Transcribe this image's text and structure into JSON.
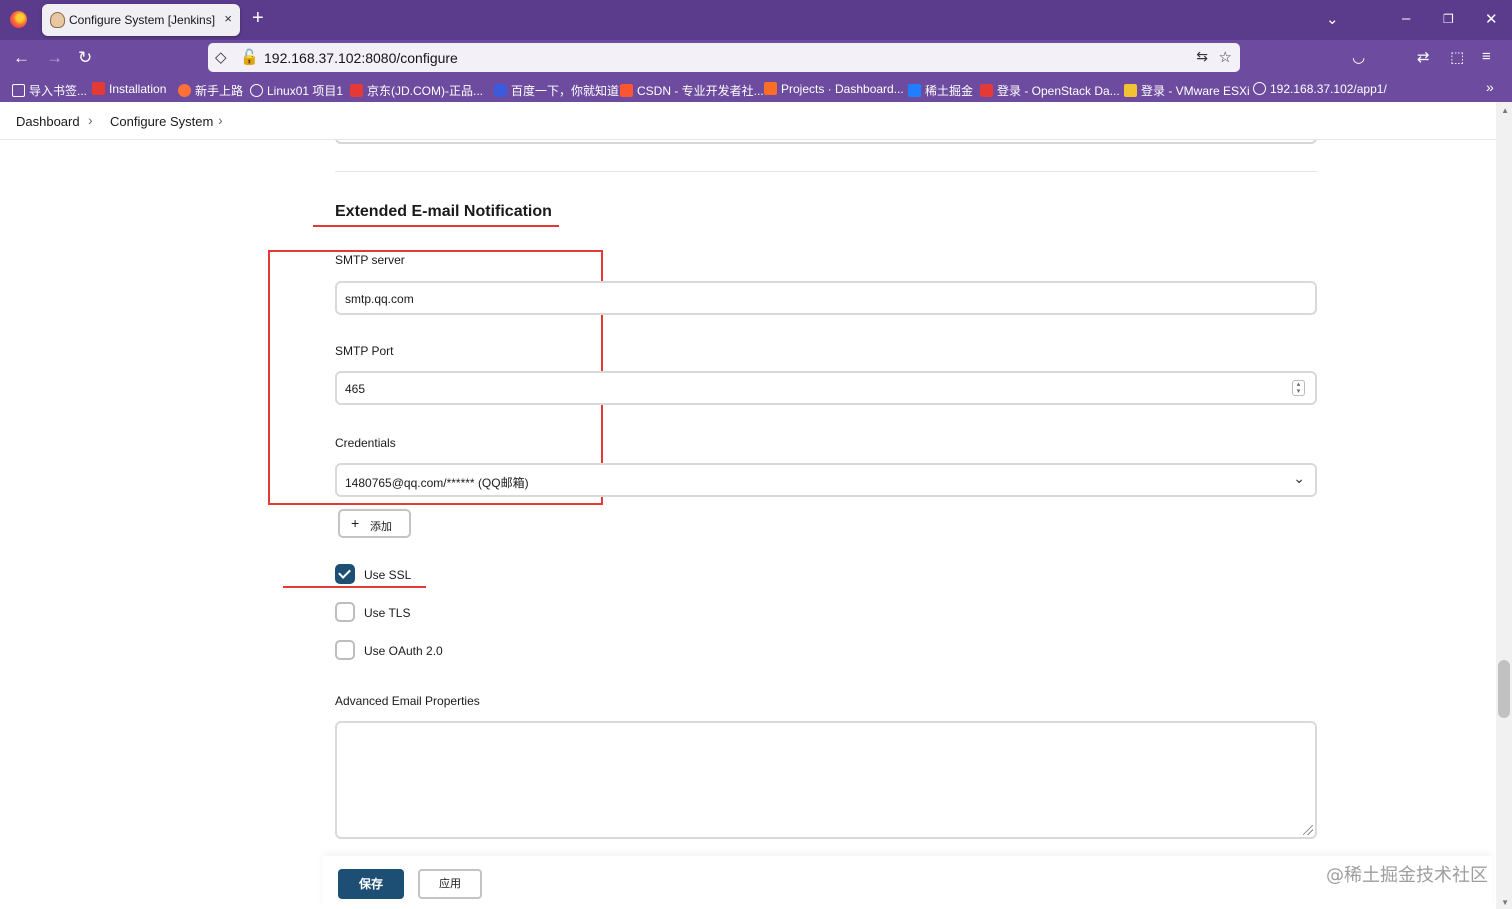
{
  "browser": {
    "tab_title": "Configure System [Jenkins]",
    "tab_close": "×",
    "new_tab": "+",
    "url": "192.168.37.102:8080/configure",
    "bookmarks": [
      {
        "label": "导入书签...",
        "color": "#ffffff"
      },
      {
        "label": "Installation",
        "color": "#e53935"
      },
      {
        "label": "新手上路",
        "color": "#ff7139"
      },
      {
        "label": "Linux01 项目1",
        "color": "#ffffff"
      },
      {
        "label": "京东(JD.COM)-正品...",
        "color": "#e53935"
      },
      {
        "label": "百度一下，你就知道",
        "color": "#3b5bdb"
      },
      {
        "label": "CSDN - 专业开发者社...",
        "color": "#fc5531"
      },
      {
        "label": "Projects · Dashboard...",
        "color": "#fc6d26"
      },
      {
        "label": "稀土掘金",
        "color": "#1e80ff"
      },
      {
        "label": "登录 - OpenStack Da...",
        "color": "#e53935"
      },
      {
        "label": "登录 - VMware ESXi",
        "color": "#f2c230"
      },
      {
        "label": "192.168.37.102/app1/",
        "color": "#ffffff"
      }
    ]
  },
  "breadcrumb": {
    "items": [
      "Dashboard",
      "Configure System"
    ],
    "separator": "›"
  },
  "section": {
    "title": "Extended E-mail Notification"
  },
  "smtp_server": {
    "label": "SMTP server",
    "value": "smtp.qq.com"
  },
  "smtp_port": {
    "label": "SMTP Port",
    "value": "465"
  },
  "credentials": {
    "label": "Credentials",
    "value": "1480765@qq.com/****** (QQ邮箱)"
  },
  "add_button": {
    "icon": "+",
    "label": "添加"
  },
  "options": {
    "use_ssl": {
      "label": "Use SSL",
      "checked": true
    },
    "use_tls": {
      "label": "Use TLS",
      "checked": false
    },
    "use_oauth": {
      "label": "Use OAuth 2.0",
      "checked": false
    }
  },
  "advanced": {
    "label": "Advanced Email Properties",
    "value": ""
  },
  "actions": {
    "save": "保存",
    "apply": "应用"
  },
  "watermark": "@稀土掘金技术社区",
  "colors": {
    "title_bar": "#5b3b8c",
    "nav_bar": "#6d4c9f",
    "jenkins_primary": "#1d4f74",
    "annotation_red": "#e53935"
  }
}
